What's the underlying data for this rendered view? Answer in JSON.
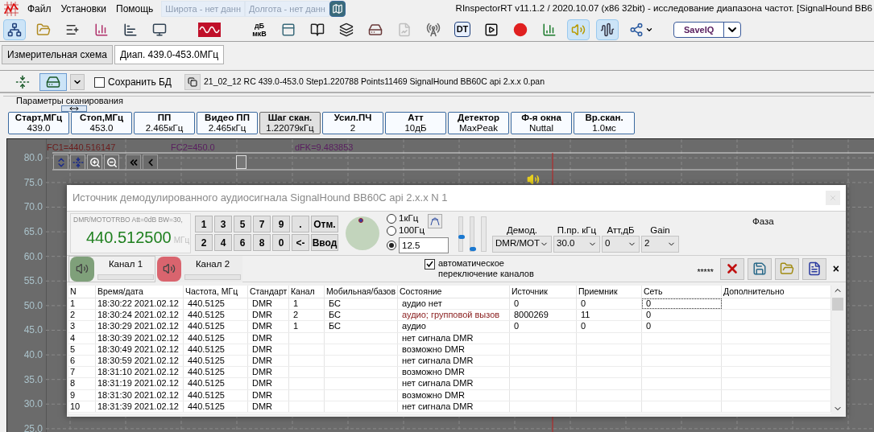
{
  "menu": {
    "items": [
      "Файл",
      "Установки",
      "Помощь"
    ],
    "latitude": "Широта - нет данн",
    "longitude": "Долгота - нет данн"
  },
  "window": {
    "title": "RInspectorRT v11.1.2 / 2020.10.07 (x86 32bit) - исследование диапазона частот. [SignalHound BB6"
  },
  "toolbar": [
    {
      "kind": "icon",
      "pressed": true,
      "disabled": false
    },
    {
      "kind": "icon",
      "pressed": false,
      "disabled": false
    },
    {
      "kind": "icon",
      "pressed": false,
      "disabled": false
    },
    {
      "kind": "icon",
      "pressed": false,
      "disabled": false
    },
    {
      "kind": "icon",
      "pressed": false,
      "disabled": false
    },
    {
      "kind": "icon",
      "pressed": false,
      "disabled": false
    },
    {
      "kind": "wide",
      "pressed": false,
      "disabled": false
    },
    {
      "kind": "text",
      "lines": [
        "дБ",
        "мкВ"
      ],
      "pressed": false,
      "disabled": false
    },
    {
      "kind": "icon",
      "pressed": false,
      "disabled": false
    },
    {
      "kind": "icon",
      "pressed": false,
      "disabled": false
    },
    {
      "kind": "icon",
      "pressed": false,
      "disabled": false
    },
    {
      "kind": "icon",
      "pressed": false,
      "disabled": false
    },
    {
      "kind": "icon",
      "pressed": false,
      "disabled": true
    },
    {
      "kind": "icon",
      "pressed": false,
      "disabled": false
    },
    {
      "kind": "label",
      "label": "DT",
      "pressed": false,
      "disabled": false
    },
    {
      "kind": "icon",
      "pressed": false,
      "disabled": false
    },
    {
      "kind": "icon",
      "pressed": false,
      "disabled": false
    },
    {
      "kind": "icon",
      "pressed": false,
      "disabled": false
    },
    {
      "kind": "icon",
      "pressed": true,
      "disabled": false
    },
    {
      "kind": "icon",
      "pressed": true,
      "disabled": false
    },
    {
      "kind": "menu",
      "pressed": false,
      "disabled": false
    },
    {
      "kind": "split",
      "label": "SaveIQ",
      "pressed": false,
      "disabled": false
    }
  ],
  "tabs": [
    {
      "label": "Измерительная схема",
      "selected": false
    },
    {
      "label": "Диап. 439.0-453.0МГц",
      "selected": true
    }
  ],
  "scan_bar": {
    "buttons": [
      {
        "pressed": false
      },
      {
        "pressed": true
      }
    ],
    "save_db": {
      "label": "Сохранить БД",
      "checked": false
    },
    "file": "21_02_12 RC 439.0-453.0 Step1.220788 Points11469 SignalHound BB60C api 2.x.x 0.pan"
  },
  "scan_params": {
    "title": "Параметры сканирования",
    "items": [
      {
        "label": "Старт,МГц",
        "value": "439.0",
        "selected": false
      },
      {
        "label": "Стоп,МГц",
        "value": "453.0",
        "selected": false
      },
      {
        "label": "ПП",
        "value": "2.465кГц",
        "selected": false
      },
      {
        "label": "Видео ПП",
        "value": "2.465кГц",
        "selected": false
      },
      {
        "label": "Шаг скан.",
        "value": "1.22079кГц",
        "selected": true
      },
      {
        "label": "Усил.ПЧ",
        "value": "2",
        "selected": false
      },
      {
        "label": "Атт",
        "value": "10дБ",
        "selected": false
      },
      {
        "label": "Детектор",
        "value": "MaxPeak",
        "selected": false
      },
      {
        "label": "Ф-я окна",
        "value": "Nuttal",
        "selected": false
      },
      {
        "label": "Вр.скан.",
        "value": "1.0мс",
        "selected": false
      }
    ]
  },
  "chart": {
    "markers": [
      {
        "label": "FC1=440.516147",
        "color": "#6b1d1d"
      },
      {
        "label": "FC2=450.0",
        "color": "#5a2060"
      },
      {
        "label": "dFK=9.483853",
        "color": "#5a2060"
      }
    ],
    "y_labels": [
      "80.0",
      "75.0",
      "70.0",
      "65.0",
      "60.0",
      "55.0",
      "50.0",
      "45.0",
      "40.0",
      "35.0",
      "30.0",
      "25.0"
    ]
  },
  "dialog": {
    "title": "Источник демодулированного аудиосигнала SignalHound BB60C api 2.x.x N 1",
    "info": "DMR/MOTOTRBO Att=0dB BW=30,",
    "frequency": "440.512500",
    "unit": "МГц",
    "keypad": [
      [
        "1",
        "3",
        "5",
        "7",
        "9",
        ".",
        "Отм."
      ],
      [
        "2",
        "4",
        "6",
        "8",
        "0",
        "<-",
        "Ввод"
      ]
    ],
    "steps": [
      {
        "label": "1кГц",
        "selected": false
      },
      {
        "label": "100Гц",
        "selected": false
      }
    ],
    "custom_step": {
      "value": "12.5",
      "selected": true
    },
    "sliders": [
      {
        "level": 0.4
      },
      {
        "level": 0.05
      }
    ],
    "selects": [
      {
        "label": "Демод.",
        "value": "DMR/MOT"
      },
      {
        "label": "П.пр. кГц",
        "value": "30.0"
      },
      {
        "label": "Атт,дБ",
        "value": "0"
      },
      {
        "label": "Gain",
        "value": "2"
      }
    ],
    "phase": "Фаза",
    "channels": [
      {
        "label": "Канал 1",
        "selected": true,
        "color": "#7fa07a"
      },
      {
        "label": "Канал 2",
        "selected": false,
        "color": "#d9646e"
      }
    ],
    "auto_switch": {
      "label": "автоматическое переключение каналов",
      "checked": true
    },
    "stars": "*****",
    "close_panel": "×",
    "table": {
      "columns": [
        "N",
        "Время/дата",
        "Частота, МГц",
        "Стандарт",
        "Канал",
        "Мобильная/базов",
        "Состояние",
        "Источник",
        "Приемник",
        "Сеть",
        "Дополнительно"
      ],
      "rows": [
        {
          "cells": [
            "1",
            "18:30:22 2021.02.12",
            "440.5125",
            "DMR",
            "1",
            "БС",
            "аудио нет",
            "0",
            "0",
            "0",
            ""
          ],
          "focused": true
        },
        {
          "cells": [
            "2",
            "18:30:24 2021.02.12",
            "440.5125",
            "DMR",
            "2",
            "БС",
            "аудио; групповой вызов",
            "8000269",
            "11",
            "0",
            ""
          ],
          "color": "#8b2020",
          "focused": false
        },
        {
          "cells": [
            "3",
            "18:30:29 2021.02.12",
            "440.5125",
            "DMR",
            "1",
            "БС",
            "аудио",
            "0",
            "0",
            "0",
            ""
          ],
          "focused": false
        },
        {
          "cells": [
            "4",
            "18:30:39 2021.02.12",
            "440.5125",
            "DMR",
            "",
            "",
            "нет сигнала DMR",
            "",
            "",
            "",
            ""
          ],
          "focused": false
        },
        {
          "cells": [
            "5",
            "18:30:49 2021.02.12",
            "440.5125",
            "DMR",
            "",
            "",
            "возможно DMR",
            "",
            "",
            "",
            ""
          ],
          "focused": false
        },
        {
          "cells": [
            "6",
            "18:30:59 2021.02.12",
            "440.5125",
            "DMR",
            "",
            "",
            "нет сигнала DMR",
            "",
            "",
            "",
            ""
          ],
          "focused": false
        },
        {
          "cells": [
            "7",
            "18:31:10 2021.02.12",
            "440.5125",
            "DMR",
            "",
            "",
            "возможно DMR",
            "",
            "",
            "",
            ""
          ],
          "focused": false
        },
        {
          "cells": [
            "8",
            "18:31:19 2021.02.12",
            "440.5125",
            "DMR",
            "",
            "",
            "нет сигнала DMR",
            "",
            "",
            "",
            ""
          ],
          "focused": false
        },
        {
          "cells": [
            "9",
            "18:31:30 2021.02.12",
            "440.5125",
            "DMR",
            "",
            "",
            "возможно DMR",
            "",
            "",
            "",
            ""
          ],
          "focused": false
        },
        {
          "cells": [
            "10",
            "18:31:39 2021.02.12",
            "440.5125",
            "DMR",
            "",
            "",
            "нет сигнала DMR",
            "",
            "",
            "",
            ""
          ],
          "focused": false
        }
      ]
    }
  }
}
